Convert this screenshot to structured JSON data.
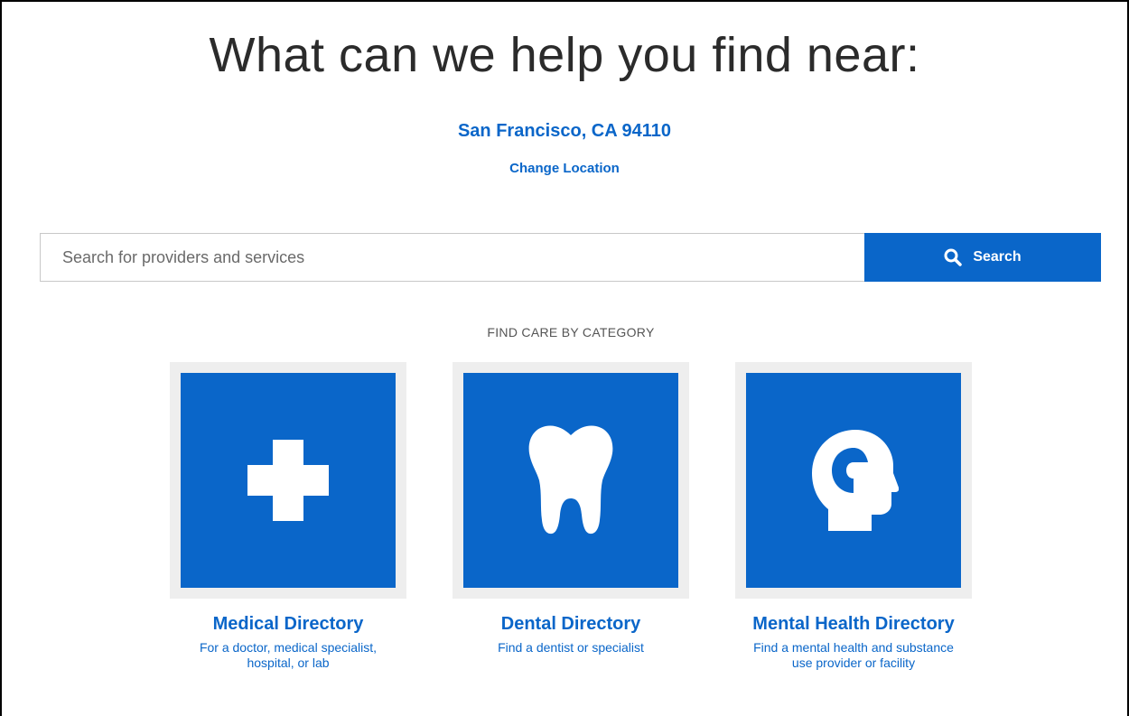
{
  "header": {
    "title": "What can we help you find near:",
    "location": "San Francisco, CA 94110",
    "change_location_label": "Change Location"
  },
  "search": {
    "placeholder": "Search for providers and services",
    "value": "",
    "button_label": "Search"
  },
  "categories": {
    "heading": "FIND CARE BY CATEGORY",
    "items": [
      {
        "title": "Medical Directory",
        "description": "For a doctor, medical specialist, hospital, or lab",
        "icon": "medical-cross-icon"
      },
      {
        "title": "Dental Directory",
        "description": "Find a dentist or specialist",
        "icon": "tooth-icon"
      },
      {
        "title": "Mental Health Directory",
        "description": "Find a mental health and substance use provider or facility",
        "icon": "head-profile-icon"
      }
    ]
  },
  "colors": {
    "accent": "#0a66c9",
    "tile_background": "#eeeeee",
    "title_text": "#2b2b2b"
  }
}
